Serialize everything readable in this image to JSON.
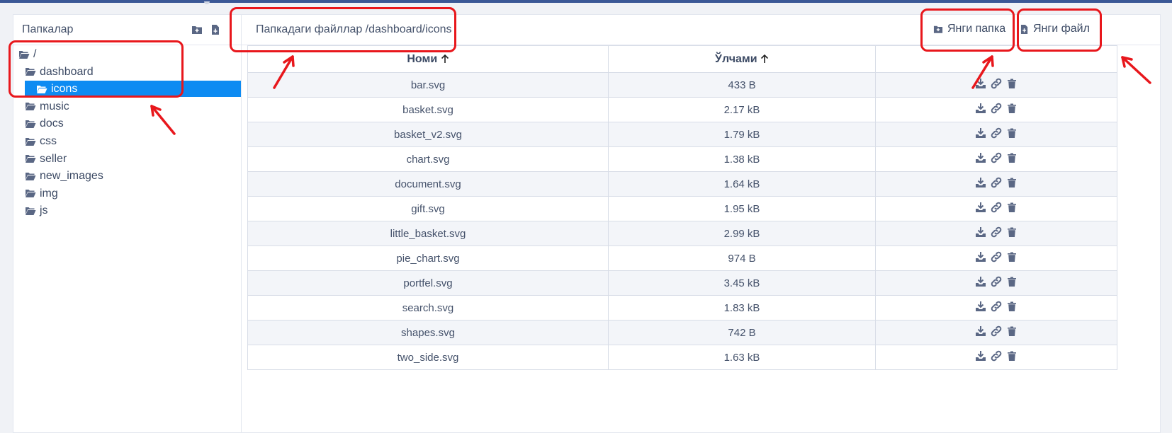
{
  "sidebar": {
    "title": "Папкалар",
    "new_folder_icon": "folder-plus-icon",
    "new_file_icon": "file-plus-icon",
    "tree": [
      {
        "label": "/",
        "selected": false
      },
      {
        "label": "dashboard",
        "selected": false
      },
      {
        "label": "icons",
        "selected": true
      },
      {
        "label": "music",
        "selected": false
      },
      {
        "label": "docs",
        "selected": false
      },
      {
        "label": "css",
        "selected": false
      },
      {
        "label": "seller",
        "selected": false
      },
      {
        "label": "new_images",
        "selected": false
      },
      {
        "label": "img",
        "selected": false
      },
      {
        "label": "js",
        "selected": false
      }
    ]
  },
  "main": {
    "path_title": "Папкадаги файллар /dashboard/icons",
    "new_folder_label": "Янги папка",
    "new_file_label": "Янги файл",
    "columns": {
      "name": "Номи",
      "size": "Ўлчами",
      "sort_icon": "arrow-up-icon"
    },
    "files": [
      {
        "name": "bar.svg",
        "size": "433 B"
      },
      {
        "name": "basket.svg",
        "size": "2.17 kB"
      },
      {
        "name": "basket_v2.svg",
        "size": "1.79 kB"
      },
      {
        "name": "chart.svg",
        "size": "1.38 kB"
      },
      {
        "name": "document.svg",
        "size": "1.64 kB"
      },
      {
        "name": "gift.svg",
        "size": "1.95 kB"
      },
      {
        "name": "little_basket.svg",
        "size": "2.99 kB"
      },
      {
        "name": "pie_chart.svg",
        "size": "974 B"
      },
      {
        "name": "portfel.svg",
        "size": "3.45 kB"
      },
      {
        "name": "search.svg",
        "size": "1.83 kB"
      },
      {
        "name": "shapes.svg",
        "size": "742 B"
      },
      {
        "name": "two_side.svg",
        "size": "1.63 kB"
      }
    ],
    "row_actions": [
      "download-icon",
      "link-icon",
      "trash-icon"
    ]
  },
  "theme": {
    "accent": "#0d8bf2",
    "annotation": "#e8171c",
    "text": "#3c4a64"
  }
}
